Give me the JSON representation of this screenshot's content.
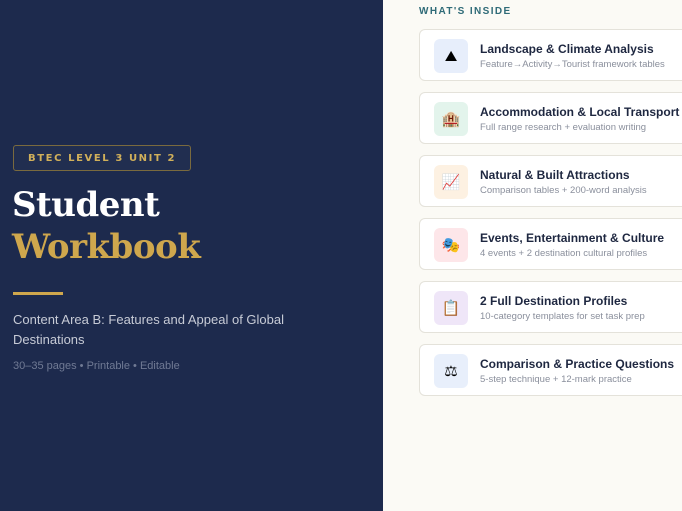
{
  "cover": {
    "badge": "BTEC LEVEL 3 UNIT 2",
    "title_line1": "Student",
    "title_line2": "Workbook",
    "subtitle": "Content Area B: Features and Appeal of Global Destinations",
    "meta": "30–35 pages • Printable • Editable"
  },
  "contents": {
    "label": "WHAT'S INSIDE",
    "items": [
      {
        "icon": "mountain-icon",
        "glyph": "⛰",
        "bg": "#e7eefb",
        "title": "Landscape & Climate Analysis",
        "desc": "Feature→Activity→Tourist framework tables"
      },
      {
        "icon": "hotel-icon",
        "glyph": "🏨",
        "bg": "#e3f4ec",
        "title": "Accommodation & Local Transport",
        "desc": "Full range research + evaluation writing"
      },
      {
        "icon": "chart-icon",
        "glyph": "📈",
        "bg": "#fdf1e2",
        "title": "Natural & Built Attractions",
        "desc": "Comparison tables + 200-word analysis"
      },
      {
        "icon": "theatre-masks-icon",
        "glyph": "🎭",
        "bg": "#fde6e9",
        "title": "Events, Entertainment & Culture",
        "desc": "4 events + 2 destination cultural profiles"
      },
      {
        "icon": "clipboard-icon",
        "glyph": "📋",
        "bg": "#efe6f8",
        "title": "2 Full Destination Profiles",
        "desc": "10-category templates for set task prep"
      },
      {
        "icon": "scales-icon",
        "glyph": "⚖",
        "bg": "#e8effb",
        "title": "Comparison & Practice Questions",
        "desc": "5-step technique + 12-mark practice"
      }
    ]
  },
  "colors": {
    "navy": "#1d2a4d",
    "gold": "#cfa74d",
    "teal": "#2f6b78"
  }
}
